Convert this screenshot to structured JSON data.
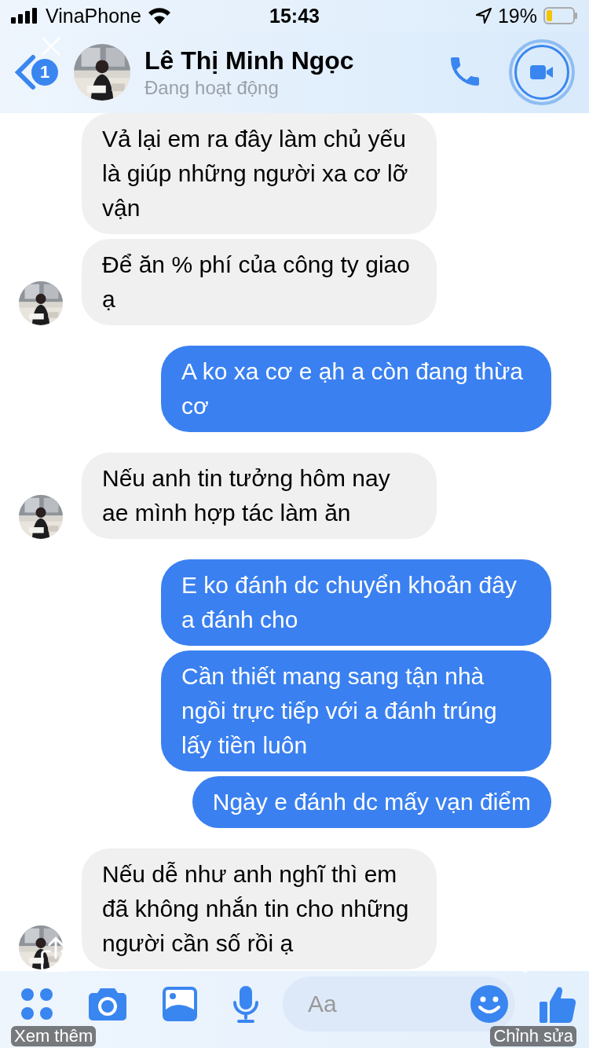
{
  "status_bar": {
    "carrier": "VinaPhone",
    "time": "15:43",
    "battery": "19%"
  },
  "header": {
    "badge": "1",
    "name": "Lê Thị Minh Ngọc",
    "status": "Đang hoạt động"
  },
  "messages": [
    {
      "kind": "incoming",
      "text": "Vả lại em ra đây làm chủ yếu là giúp những người xa cơ lỡ vận"
    },
    {
      "kind": "incoming",
      "text": "Để ăn % phí của công ty giao ạ"
    },
    {
      "kind": "outgoing",
      "text": "A ko xa cơ e ạh a còn đang thừa cơ"
    },
    {
      "kind": "incoming",
      "text": "Nếu anh tin tưởng hôm nay ae mình hợp tác làm ăn"
    },
    {
      "kind": "outgoing",
      "text": "E ko đánh dc chuyển khoản đây a đánh cho"
    },
    {
      "kind": "outgoing",
      "text": "Cần thiết mang sang tận nhà ngồi trực tiếp với a đánh trúng lấy tiền luôn"
    },
    {
      "kind": "outgoing",
      "text": "Ngày e đánh dc mấy vạn điểm"
    },
    {
      "kind": "incoming",
      "text": "Nếu dễ như anh nghĩ thì em đã không nhắn tin cho những người cần số rồi ạ"
    }
  ],
  "composer": {
    "placeholder": "Aa"
  },
  "overlay": {
    "left_label": "Xem thêm",
    "right_label": "Chỉnh sửa"
  }
}
